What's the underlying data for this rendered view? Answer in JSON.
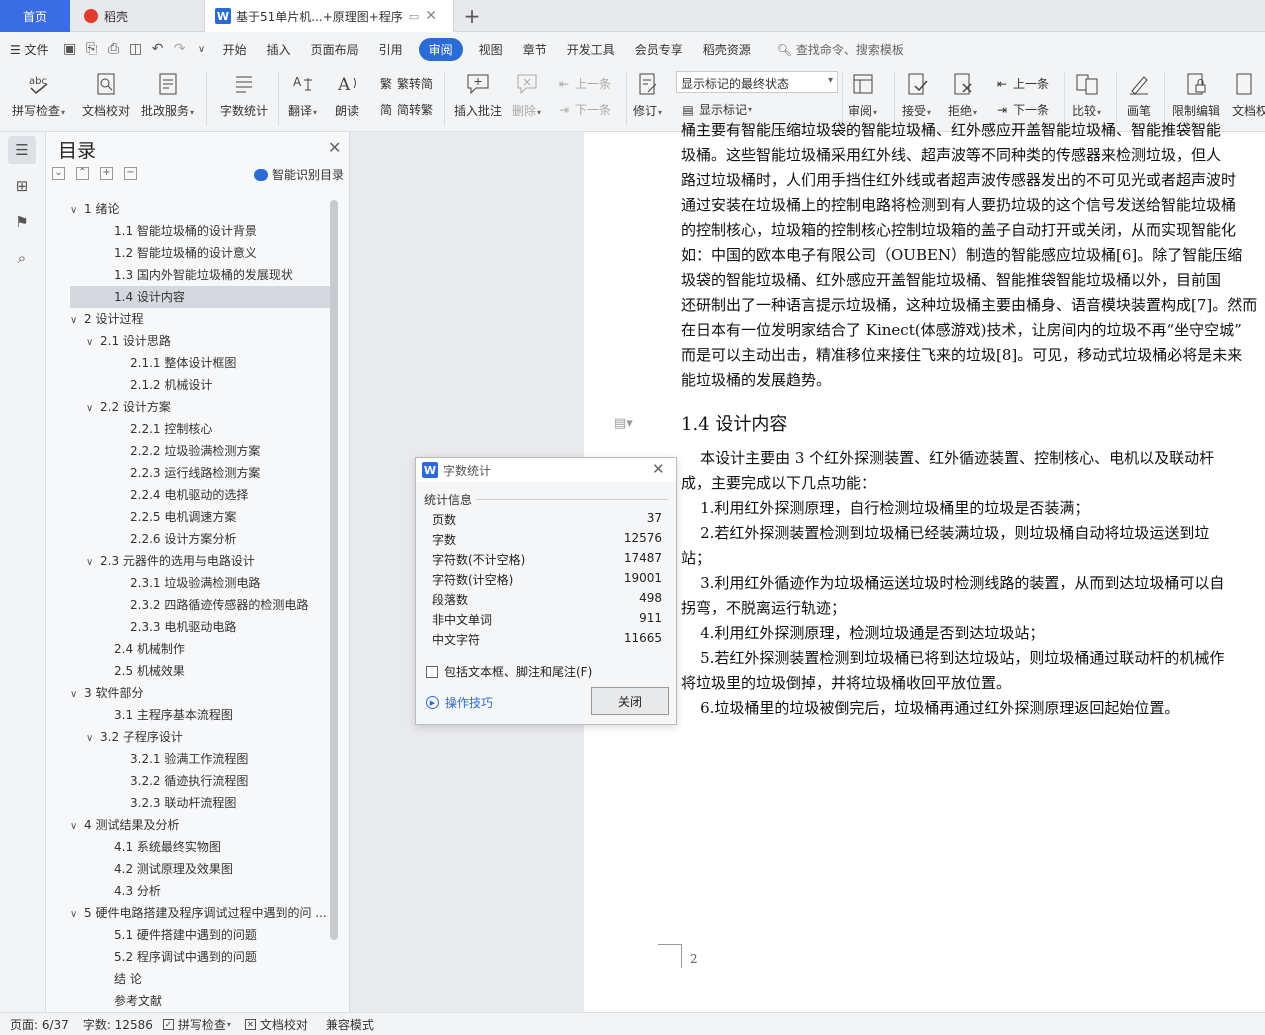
{
  "tabs": {
    "home": "首页",
    "daoke": "稻壳",
    "doc": "基于51单片机...+原理图+程序"
  },
  "menu": {
    "file": "文件",
    "items": [
      "开始",
      "插入",
      "页面布局",
      "引用",
      "审阅",
      "视图",
      "章节",
      "开发工具",
      "会员专享",
      "稻壳资源"
    ],
    "active": "审阅",
    "search": "查找命令、搜索模板"
  },
  "ribbon": {
    "spell": "拼写检查",
    "doc_check": "文档校对",
    "batch": "批改服务",
    "word_count": "字数统计",
    "translate": "翻译",
    "read": "朗读",
    "trad": "繁转简",
    "simp": "简转繁",
    "insert_comment": "插入批注",
    "delete": "删除",
    "prev_comment": "上一条",
    "next_comment": "下一条",
    "revise": "修订",
    "markup_state": "显示标记的最终状态",
    "show_markup": "显示标记",
    "review": "审阅",
    "accept": "接受",
    "reject": "拒绝",
    "prev": "上一条",
    "next": "下一条",
    "compare": "比较",
    "pen": "画笔",
    "restrict": "限制编辑",
    "doc_right": "文档权"
  },
  "toc": {
    "title": "目录",
    "smart": "智能识别目录",
    "items": [
      {
        "text": "1  绪论",
        "level": 1,
        "arrow": "∨"
      },
      {
        "text": "1.1 智能垃圾桶的设计背景",
        "level": 2,
        "arrow": ""
      },
      {
        "text": "1.2 智能垃圾桶的设计意义",
        "level": 2,
        "arrow": ""
      },
      {
        "text": "1.3 国内外智能垃圾桶的发展现状",
        "level": 2,
        "arrow": ""
      },
      {
        "text": "1.4 设计内容",
        "level": 2,
        "arrow": "",
        "selected": true
      },
      {
        "text": "2  设计过程",
        "level": 1,
        "arrow": "∨"
      },
      {
        "text": "2.1 设计思路",
        "level": 2,
        "arrow": "∨"
      },
      {
        "text": "2.1.1 整体设计框图",
        "level": 3,
        "arrow": ""
      },
      {
        "text": "2.1.2 机械设计",
        "level": 3,
        "arrow": ""
      },
      {
        "text": "2.2 设计方案",
        "level": 2,
        "arrow": "∨"
      },
      {
        "text": "2.2.1 控制核心",
        "level": 3,
        "arrow": ""
      },
      {
        "text": "2.2.2 垃圾验满检测方案",
        "level": 3,
        "arrow": ""
      },
      {
        "text": "2.2.3 运行线路检测方案",
        "level": 3,
        "arrow": ""
      },
      {
        "text": "2.2.4 电机驱动的选择",
        "level": 3,
        "arrow": ""
      },
      {
        "text": "2.2.5 电机调速方案",
        "level": 3,
        "arrow": ""
      },
      {
        "text": "2.2.6 设计方案分析",
        "level": 3,
        "arrow": ""
      },
      {
        "text": "2.3 元器件的选用与电路设计",
        "level": 2,
        "arrow": "∨"
      },
      {
        "text": "2.3.1 垃圾验满检测电路",
        "level": 3,
        "arrow": ""
      },
      {
        "text": "2.3.2 四路循迹传感器的检测电路",
        "level": 3,
        "arrow": ""
      },
      {
        "text": "2.3.3 电机驱动电路",
        "level": 3,
        "arrow": ""
      },
      {
        "text": "2.4 机械制作",
        "level": 2,
        "arrow": ""
      },
      {
        "text": "2.5 机械效果",
        "level": 2,
        "arrow": ""
      },
      {
        "text": "3  软件部分",
        "level": 1,
        "arrow": "∨"
      },
      {
        "text": "3.1 主程序基本流程图",
        "level": 2,
        "arrow": ""
      },
      {
        "text": "3.2 子程序设计",
        "level": 2,
        "arrow": "∨"
      },
      {
        "text": "3.2.1 验满工作流程图",
        "level": 3,
        "arrow": ""
      },
      {
        "text": "3.2.2 循迹执行流程图",
        "level": 3,
        "arrow": ""
      },
      {
        "text": "3.2.3 联动杆流程图",
        "level": 3,
        "arrow": ""
      },
      {
        "text": "4  测试结果及分析",
        "level": 1,
        "arrow": "∨"
      },
      {
        "text": "4.1 系统最终实物图",
        "level": 2,
        "arrow": ""
      },
      {
        "text": "4.2 测试原理及效果图",
        "level": 2,
        "arrow": ""
      },
      {
        "text": "4.3 分析",
        "level": 2,
        "arrow": ""
      },
      {
        "text": "5  硬件电路搭建及程序调试过程中遇到的问 ...",
        "level": 1,
        "arrow": "∨"
      },
      {
        "text": "5.1 硬件搭建中遇到的问题",
        "level": 2,
        "arrow": ""
      },
      {
        "text": "5.2 程序调试中遇到的问题",
        "level": 2,
        "arrow": ""
      },
      {
        "text": "结    论",
        "level": 0,
        "arrow": ""
      },
      {
        "text": "参考文献",
        "level": 0,
        "arrow": ""
      }
    ]
  },
  "document": {
    "lines_top": [
      "桶主要有智能压缩垃圾袋的智能垃圾桶、红外感应开盖智能垃圾桶、智能推袋智能",
      "圾桶。这些智能垃圾桶采用红外线、超声波等不同种类的传感器来检测垃圾，但人",
      "路过垃圾桶时，人们用手挡住红外线或者超声波传感器发出的不可见光或者超声波时",
      "通过安装在垃圾桶上的控制电路将检测到有人要扔垃圾的这个信号发送给智能垃圾桶",
      "的控制核心，垃圾箱的控制核心控制垃圾箱的盖子自动打开或关闭，从而实现智能化",
      "如：中国的欧本电子有限公司（OUBEN）制造的智能感应垃圾桶[6]。除了智能压缩",
      "圾袋的智能垃圾桶、红外感应开盖智能垃圾桶、智能推袋智能垃圾桶以外，目前国",
      "还研制出了一种语言提示垃圾桶，这种垃圾桶主要由桶身、语音模块装置构成[7]。然而",
      "在日本有一位发明家结合了 Kinect(体感游戏)技术，让房间内的垃圾不再“坐守空城”",
      "而是可以主动出击，精准移位来接住飞来的垃圾[8]。可见，移动式垃圾桶必将是未来",
      "能垃圾桶的发展趋势。"
    ],
    "section_title": "1.4 设计内容",
    "lines_bottom": [
      "    本设计主要由 3 个红外探测装置、红外循迹装置、控制核心、电机以及联动杆",
      "成，主要完成以下几点功能：",
      "    1.利用红外探测原理，自行检测垃圾桶里的垃圾是否装满；",
      "    2.若红外探测装置检测到垃圾桶已经装满垃圾，则垃圾桶自动将垃圾运送到垃",
      "站；",
      "    3.利用红外循迹作为垃圾桶运送垃圾时检测线路的装置，从而到达垃圾桶可以自",
      "拐弯，不脱离运行轨迹；",
      "    4.利用红外探测原理，检测垃圾通是否到达垃圾站；",
      "    5.若红外探测装置检测到垃圾桶已将到达垃圾站，则垃圾桶通过联动杆的机械作",
      "将垃圾里的垃圾倒掉，并将垃圾桶收回平放位置。",
      "    6.垃圾桶里的垃圾被倒完后，垃圾桶再通过红外探测原理返回起始位置。"
    ],
    "page_number": "2"
  },
  "dialog": {
    "title": "字数统计",
    "section": "统计信息",
    "stats": [
      {
        "label": "页数",
        "value": "37"
      },
      {
        "label": "字数",
        "value": "12576"
      },
      {
        "label": "字符数(不计空格)",
        "value": "17487"
      },
      {
        "label": "字符数(计空格)",
        "value": "19001"
      },
      {
        "label": "段落数",
        "value": "498"
      },
      {
        "label": "非中文单词",
        "value": "911"
      },
      {
        "label": "中文字符",
        "value": "11665"
      }
    ],
    "checkbox": "包括文本框、脚注和尾注(F)",
    "tips": "操作技巧",
    "close": "关闭"
  },
  "status": {
    "page": "页面: 6/37",
    "words": "字数: 12586",
    "spell": "拼写检查",
    "doc_check": "文档校对",
    "compat": "兼容模式"
  },
  "colors": {
    "accent": "#2a6bd6",
    "home_tab": "#3a6de3",
    "selected_toc": "#d5d8de"
  }
}
